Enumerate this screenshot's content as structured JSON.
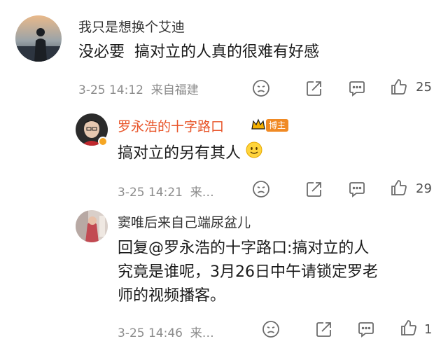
{
  "comments": [
    {
      "username": "我只是想换个艾迪",
      "text": "没必要  搞对立的人真的很难有好感",
      "meta": "3-25 14:12  来自福建",
      "likes": "25"
    },
    {
      "username": "罗永浩的十字路口",
      "badge": "博主",
      "text": "搞对立的另有其人",
      "meta": "3-25 14:21  来…",
      "likes": "29"
    },
    {
      "username": "窦唯后来自己端尿盆儿",
      "text_lines": [
        "回复@罗永浩的十字路口:搞对立的人",
        "究竟是谁呢，3月26日中午请锁定罗老",
        "师的视频播客。"
      ],
      "meta": "3-25 14:46  来…",
      "likes": "1"
    }
  ],
  "colors": {
    "host_name": "#e8552a",
    "username": "#333333",
    "meta": "#8c8c8c",
    "icon": "#6b6b6b",
    "badge": "#f08a24"
  },
  "icons": [
    "avatar",
    "crown-icon",
    "verified-icon",
    "smiley-emoji",
    "dislike-face-icon",
    "share-icon",
    "comment-icon",
    "like-icon"
  ]
}
